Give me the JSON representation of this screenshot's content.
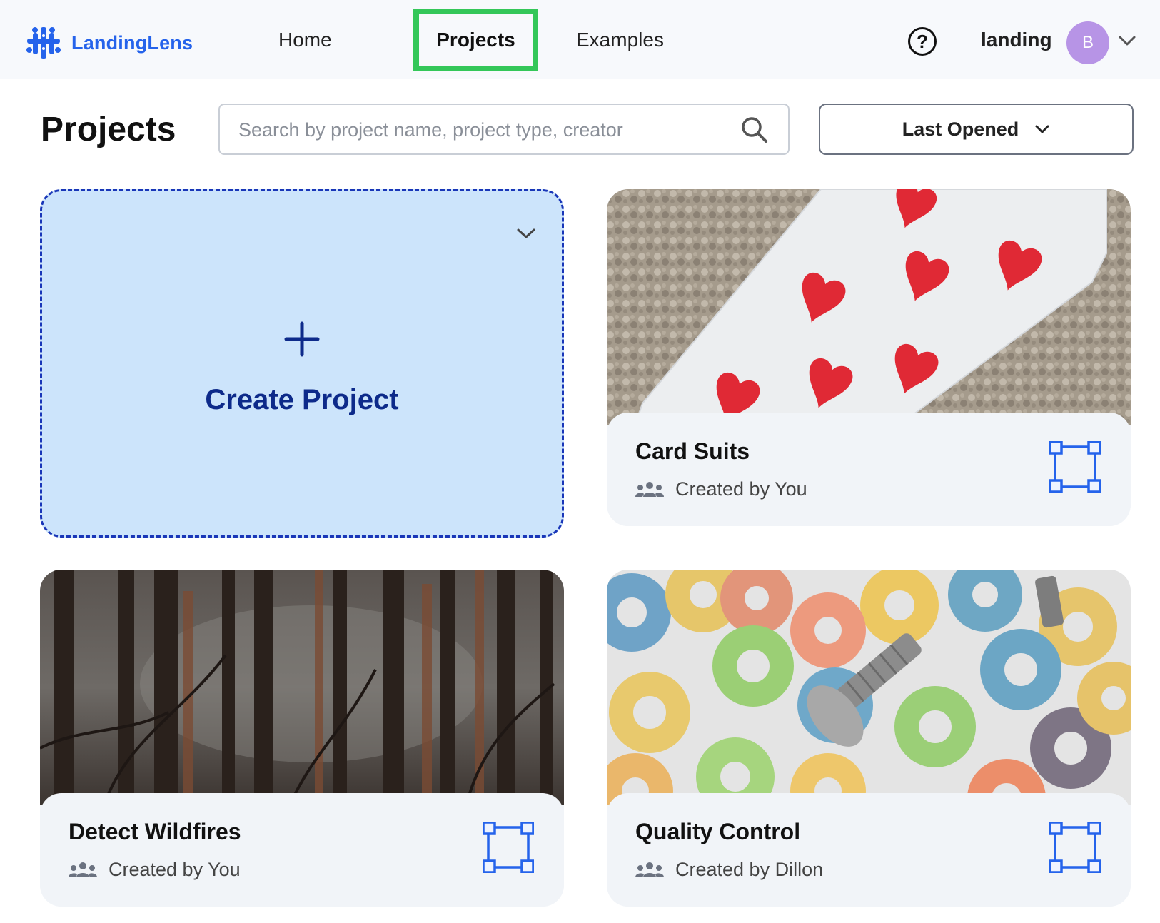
{
  "app": {
    "name": "LandingLens"
  },
  "nav": {
    "home": "Home",
    "projects": "Projects",
    "examples": "Examples"
  },
  "user": {
    "name": "landing",
    "avatar_initial": "B",
    "avatar_color": "#b794e6"
  },
  "page": {
    "title": "Projects",
    "search_placeholder": "Search by project name, project type, creator",
    "sort_label": "Last Opened"
  },
  "create_card": {
    "label": "Create Project"
  },
  "projects": [
    {
      "name": "Card Suits",
      "creator": "Created by You",
      "type_icon": "object-detection-icon"
    },
    {
      "name": "Detect Wildfires",
      "creator": "Created by You",
      "type_icon": "object-detection-icon"
    },
    {
      "name": "Quality Control",
      "creator": "Created by Dillon",
      "type_icon": "object-detection-icon"
    }
  ],
  "colors": {
    "brand": "#2563eb",
    "active_highlight": "#34c759",
    "create_bg": "#cce4fb",
    "create_border": "#1936b8"
  }
}
